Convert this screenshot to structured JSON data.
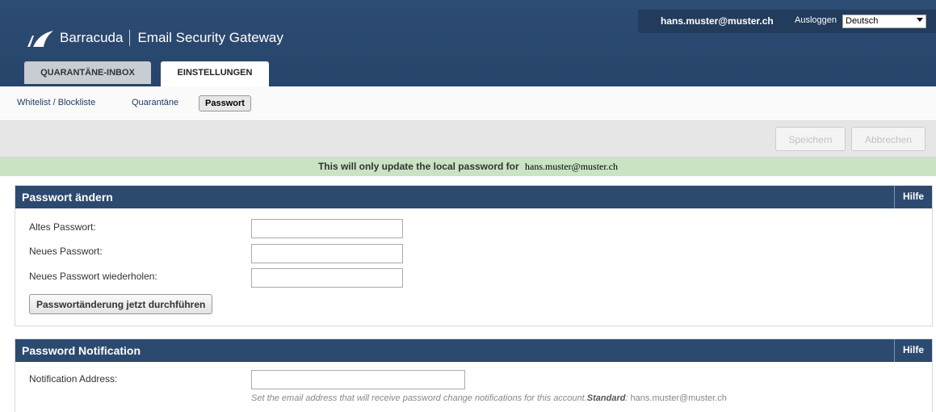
{
  "header": {
    "brand": "Barracuda",
    "product": "Email Security Gateway",
    "user_email": "hans.muster@muster.ch",
    "logout_label": "Ausloggen",
    "language_selected": "Deutsch"
  },
  "tabs": [
    {
      "label": "QUARANTÄNE-INBOX",
      "active": false
    },
    {
      "label": "EINSTELLUNGEN",
      "active": true
    }
  ],
  "subnav": {
    "items": [
      "Whitelist / Blockliste",
      "Quarantäne",
      "Passwort"
    ],
    "active": "Passwort"
  },
  "actions": {
    "save_label": "Speichern",
    "cancel_label": "Abbrechen"
  },
  "notice": {
    "text": "This will only update the local password for",
    "address": "hans.muster@muster.ch"
  },
  "password_panel": {
    "title": "Passwort ändern",
    "help_label": "Hilfe",
    "fields": [
      {
        "label": "Altes Passwort:",
        "value": ""
      },
      {
        "label": "Neues Passwort:",
        "value": ""
      },
      {
        "label": "Neues Passwort wiederholen:",
        "value": ""
      }
    ],
    "submit_label": "Passwortänderung jetzt durchführen"
  },
  "notification_panel": {
    "title": "Password Notification",
    "help_label": "Hilfe",
    "field_label": "Notification Address:",
    "field_value": "",
    "hint_text": "Set the email address that will receive password change notifications for this account.",
    "hint_default_label": "Standard",
    "hint_default_value": "hans.muster@muster.ch"
  },
  "colors": {
    "header_bg": "#2c4a6f",
    "notice_bg": "#c9e3c3"
  }
}
